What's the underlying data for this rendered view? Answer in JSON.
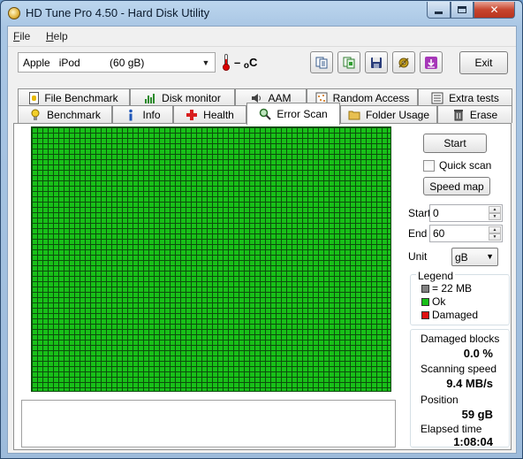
{
  "window": {
    "title": "HD Tune Pro 4.50 - Hard Disk Utility"
  },
  "menu": [
    {
      "label": "File",
      "underline": "F",
      "rest": "ile"
    },
    {
      "label": "Help",
      "underline": "H",
      "rest": "elp"
    }
  ],
  "toolbar": {
    "drive": "Apple   iPod          (60 gB)",
    "temperature": "– °C",
    "temp_display": "– ₐC",
    "exit_label": "Exit",
    "buttons": [
      "copy-info-icon",
      "copy-screenshot-icon",
      "save-icon",
      "options-icon",
      "download-icon"
    ]
  },
  "tabs": {
    "row1": [
      "File Benchmark",
      "Disk monitor",
      "AAM",
      "Random Access",
      "Extra tests"
    ],
    "row2": [
      "Benchmark",
      "Info",
      "Health",
      "Error Scan",
      "Folder Usage",
      "Erase"
    ],
    "active": "Error Scan"
  },
  "scan": {
    "start_label": "Start",
    "quick_scan_label": "Quick scan",
    "quick_scan_checked": false,
    "speed_map_label": "Speed map",
    "start_field_label": "Start",
    "start_value": "0",
    "end_field_label": "End",
    "end_value": "60",
    "unit_label": "Unit",
    "unit_value": "gB",
    "block_status": "ok"
  },
  "legend": {
    "title": "Legend",
    "items": [
      {
        "label": "= 22 MB",
        "color": "#808080"
      },
      {
        "label": "Ok",
        "color": "#18c018"
      },
      {
        "label": "Damaged",
        "color": "#e01010"
      }
    ]
  },
  "stats": {
    "damaged_label": "Damaged blocks",
    "damaged_value": "0.0 %",
    "speed_label": "Scanning speed",
    "speed_value": "9.4 MB/s",
    "position_label": "Position",
    "position_value": "59 gB",
    "elapsed_label": "Elapsed time",
    "elapsed_value": "1:08:04"
  },
  "colors": {
    "ok": "#18c018",
    "damaged": "#e01010",
    "close_button": "#c7452e"
  }
}
